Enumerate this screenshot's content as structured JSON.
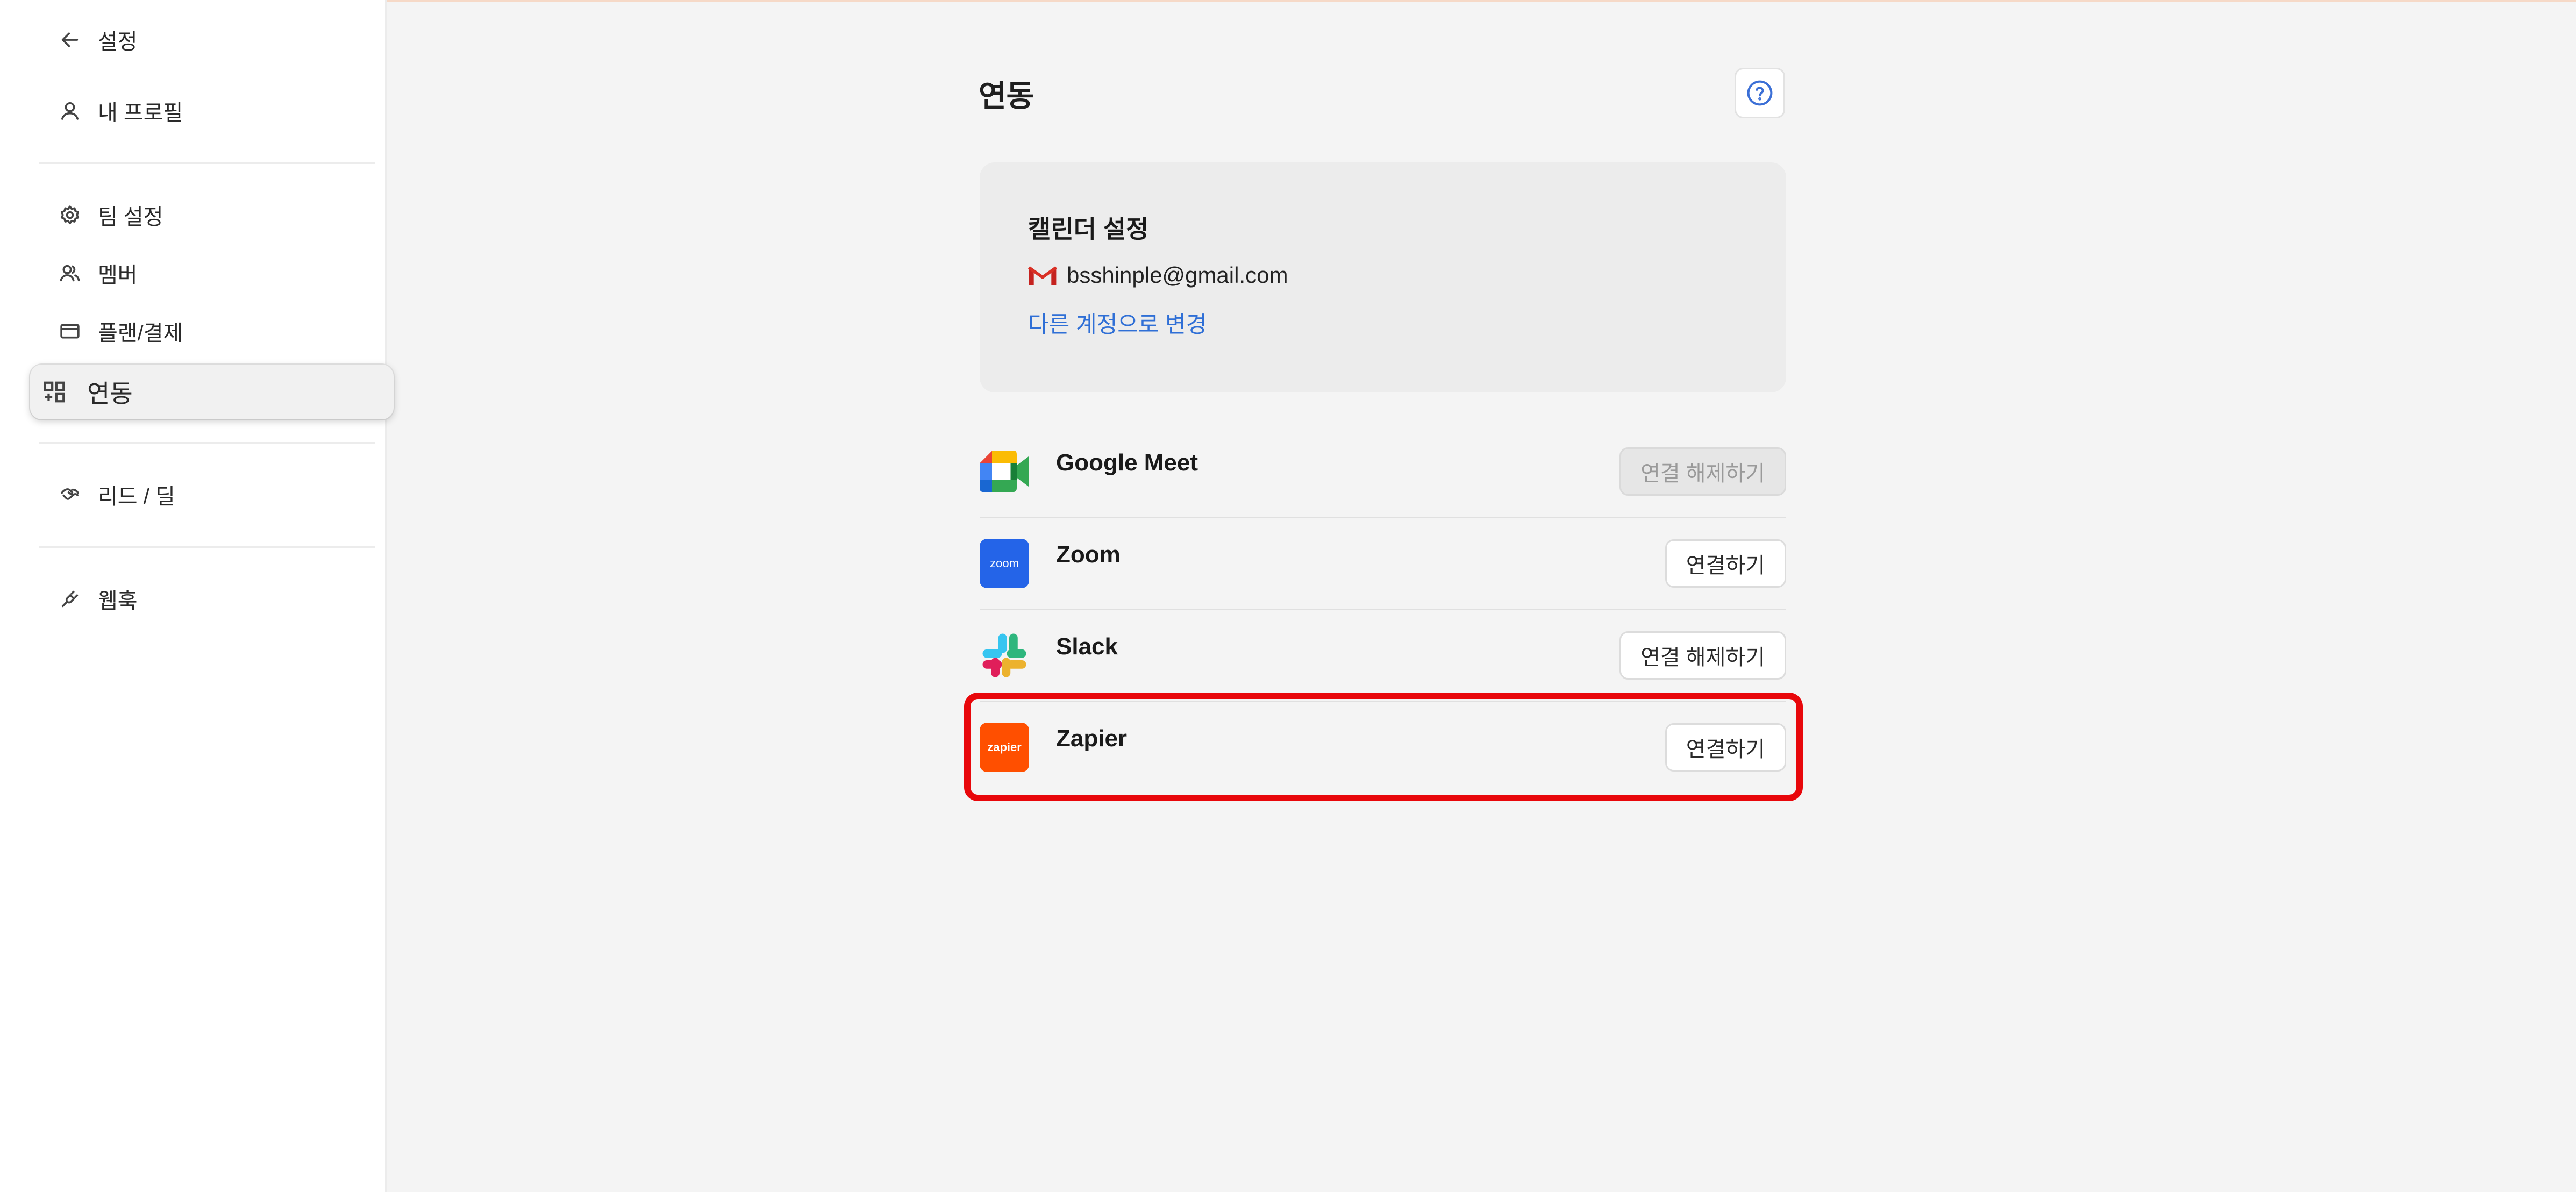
{
  "sidebar": {
    "back_label": "설정",
    "items": [
      {
        "label": "내 프로필",
        "icon": "user-icon"
      },
      {
        "label": "팀 설정",
        "icon": "gear-icon"
      },
      {
        "label": "멤버",
        "icon": "members-icon"
      },
      {
        "label": "플랜/결제",
        "icon": "card-icon"
      },
      {
        "label": "연동",
        "icon": "integration-icon",
        "active": true
      },
      {
        "label": "리드 / 딜",
        "icon": "handshake-icon"
      },
      {
        "label": "웹훅",
        "icon": "webhook-icon"
      }
    ]
  },
  "main": {
    "title": "연동",
    "help_icon": "question-circle-icon",
    "calendar": {
      "title": "캘린더 설정",
      "email": "bsshinple@gmail.com",
      "change_link": "다른 계정으로 변경"
    },
    "integrations": [
      {
        "name": "Google Meet",
        "button": "연결 해제하기",
        "disabled": true
      },
      {
        "name": "Zoom",
        "button": "연결하기",
        "logo_text": "zoom"
      },
      {
        "name": "Slack",
        "button": "연결 해제하기"
      },
      {
        "name": "Zapier",
        "button": "연결하기",
        "logo_text": "zapier",
        "highlighted": true
      }
    ]
  },
  "colors": {
    "accent_link": "#2f6fd6",
    "highlight": "#e8070b",
    "zoom": "#2464e8",
    "zapier": "#ff4f00"
  }
}
